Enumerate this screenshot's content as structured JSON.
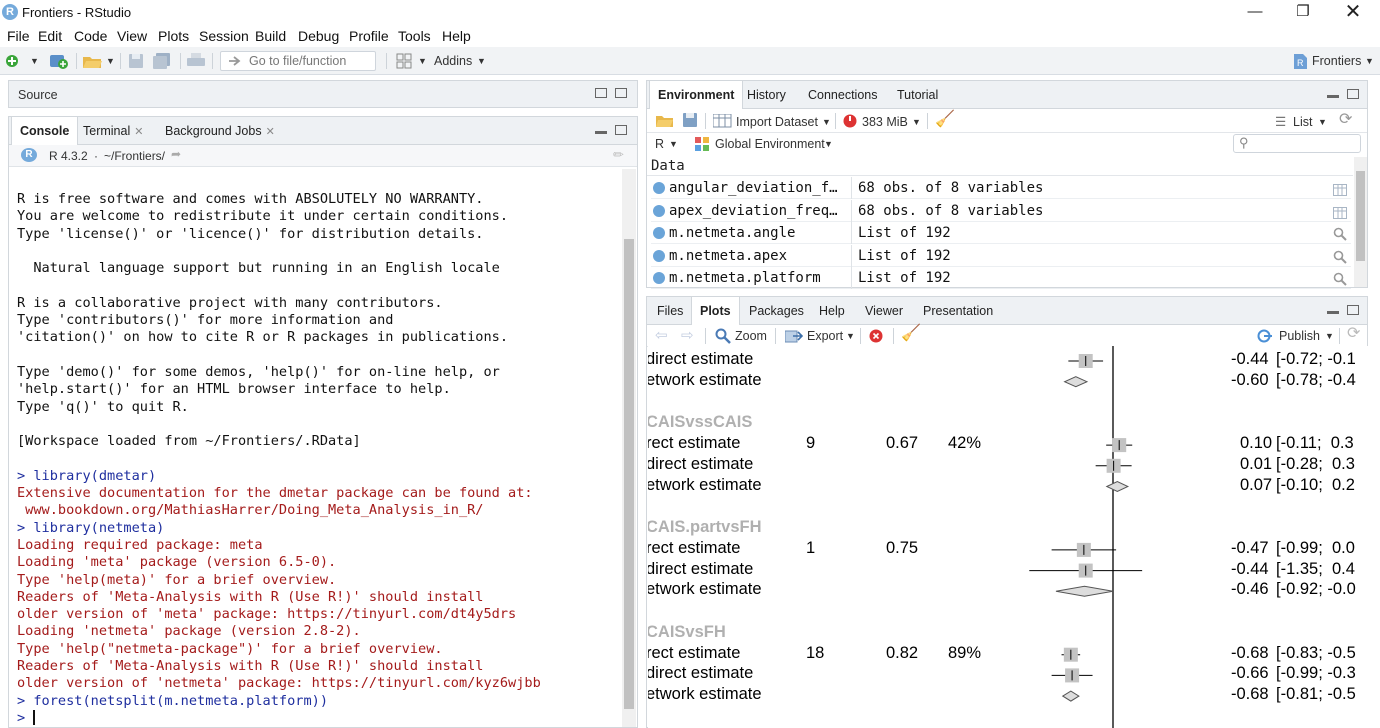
{
  "window": {
    "title": "Frontiers - RStudio",
    "app_icon": "R"
  },
  "menu": [
    "File",
    "Edit",
    "Code",
    "View",
    "Plots",
    "Session",
    "Build",
    "Debug",
    "Profile",
    "Tools",
    "Help"
  ],
  "toolbar": {
    "goto_placeholder": "Go to file/function",
    "addins_label": "Addins",
    "project_label": "Frontiers"
  },
  "source_pane": {
    "title": "Source"
  },
  "console_pane": {
    "tabs": [
      {
        "label": "Console",
        "closable": false
      },
      {
        "label": "Terminal",
        "closable": true
      },
      {
        "label": "Background Jobs",
        "closable": true
      }
    ],
    "r_version": "R 4.3.2",
    "path": "~/Frontiers/",
    "lines": [
      {
        "text": "R is free software and comes with ABSOLUTELY NO WARRANTY.",
        "kind": "black"
      },
      {
        "text": "You are welcome to redistribute it under certain conditions.",
        "kind": "black"
      },
      {
        "text": "Type 'license()' or 'licence()' for distribution details.",
        "kind": "black"
      },
      {
        "text": "",
        "kind": "black"
      },
      {
        "text": "  Natural language support but running in an English locale",
        "kind": "black"
      },
      {
        "text": "",
        "kind": "black"
      },
      {
        "text": "R is a collaborative project with many contributors.",
        "kind": "black"
      },
      {
        "text": "Type 'contributors()' for more information and",
        "kind": "black"
      },
      {
        "text": "'citation()' on how to cite R or R packages in publications.",
        "kind": "black"
      },
      {
        "text": "",
        "kind": "black"
      },
      {
        "text": "Type 'demo()' for some demos, 'help()' for on-line help, or",
        "kind": "black"
      },
      {
        "text": "'help.start()' for an HTML browser interface to help.",
        "kind": "black"
      },
      {
        "text": "Type 'q()' to quit R.",
        "kind": "black"
      },
      {
        "text": "",
        "kind": "black"
      },
      {
        "text": "[Workspace loaded from ~/Frontiers/.RData]",
        "kind": "black"
      },
      {
        "text": "",
        "kind": "black"
      },
      {
        "text": "> library(dmetar)",
        "kind": "blue"
      },
      {
        "text": "Extensive documentation for the dmetar package can be found at:",
        "kind": "red"
      },
      {
        "text": " www.bookdown.org/MathiasHarrer/Doing_Meta_Analysis_in_R/",
        "kind": "red"
      },
      {
        "text": "> library(netmeta)",
        "kind": "blue"
      },
      {
        "text": "Loading required package: meta",
        "kind": "red"
      },
      {
        "text": "Loading 'meta' package (version 6.5-0).",
        "kind": "red"
      },
      {
        "text": "Type 'help(meta)' for a brief overview.",
        "kind": "red"
      },
      {
        "text": "Readers of 'Meta-Analysis with R (Use R!)' should install",
        "kind": "red"
      },
      {
        "text": "older version of 'meta' package: https://tinyurl.com/dt4y5drs",
        "kind": "red"
      },
      {
        "text": "Loading 'netmeta' package (version 2.8-2).",
        "kind": "red"
      },
      {
        "text": "Type 'help(\"netmeta-package\")' for a brief overview.",
        "kind": "red"
      },
      {
        "text": "Readers of 'Meta-Analysis with R (Use R!)' should install",
        "kind": "red"
      },
      {
        "text": "older version of 'netmeta' package: https://tinyurl.com/kyz6wjbb",
        "kind": "red"
      },
      {
        "text": "> forest(netsplit(m.netmeta.platform))",
        "kind": "blue"
      },
      {
        "text": "> ",
        "kind": "blue"
      }
    ]
  },
  "env_pane": {
    "tabs": [
      "Environment",
      "History",
      "Connections",
      "Tutorial"
    ],
    "import_label": "Import Dataset",
    "memory_label": "383 MiB",
    "view_label": "List",
    "lang_label": "R",
    "scope_label": "Global Environment",
    "section_label": "Data",
    "rows": [
      {
        "name": "angular_deviation_f…",
        "value": "68 obs. of 8 variables",
        "action": "table-icon"
      },
      {
        "name": "apex_deviation_freq…",
        "value": "68 obs. of 8 variables",
        "action": "table-icon"
      },
      {
        "name": "m.netmeta.angle",
        "value": "List of  192",
        "action": "magnifier-icon"
      },
      {
        "name": "m.netmeta.apex",
        "value": "List of  192",
        "action": "magnifier-icon"
      },
      {
        "name": "m.netmeta.platform",
        "value": "List of  192",
        "action": "magnifier-icon"
      }
    ]
  },
  "files_pane": {
    "tabs": [
      "Files",
      "Plots",
      "Packages",
      "Help",
      "Viewer",
      "Presentation"
    ],
    "zoom_label": "Zoom",
    "export_label": "Export",
    "publish_label": "Publish"
  },
  "plot": {
    "rows": [
      {
        "kind": "row",
        "label": "direct estimate",
        "n": "",
        "w": "",
        "i2": "",
        "est": "-0.44",
        "ci": "[-0.72; -0.1"
      },
      {
        "kind": "row",
        "label": "etwork estimate",
        "n": "",
        "w": "",
        "i2": "",
        "est": "-0.60",
        "ci": "[-0.78; -0.4"
      },
      {
        "kind": "group",
        "label": "CAISvssCAIS"
      },
      {
        "kind": "row",
        "label": "rect estimate",
        "n": "9",
        "w": "0.67",
        "i2": "42%",
        "est": "0.10",
        "ci": "[-0.11;  0.3"
      },
      {
        "kind": "row",
        "label": "direct estimate",
        "n": "",
        "w": "",
        "i2": "",
        "est": "0.01",
        "ci": "[-0.28;  0.3"
      },
      {
        "kind": "row",
        "label": "etwork estimate",
        "n": "",
        "w": "",
        "i2": "",
        "est": "0.07",
        "ci": "[-0.10;  0.2"
      },
      {
        "kind": "group",
        "label": "CAIS.partvsFH"
      },
      {
        "kind": "row",
        "label": "rect estimate",
        "n": "1",
        "w": "0.75",
        "i2": "",
        "est": "-0.47",
        "ci": "[-0.99;  0.0"
      },
      {
        "kind": "row",
        "label": "direct estimate",
        "n": "",
        "w": "",
        "i2": "",
        "est": "-0.44",
        "ci": "[-1.35;  0.4"
      },
      {
        "kind": "row",
        "label": "etwork estimate",
        "n": "",
        "w": "",
        "i2": "",
        "est": "-0.46",
        "ci": "[-0.92; -0.0"
      },
      {
        "kind": "group",
        "label": "CAISvsFH"
      },
      {
        "kind": "row",
        "label": "rect estimate",
        "n": "18",
        "w": "0.82",
        "i2": "89%",
        "est": "-0.68",
        "ci": "[-0.83; -0.5"
      },
      {
        "kind": "row",
        "label": "direct estimate",
        "n": "",
        "w": "",
        "i2": "",
        "est": "-0.66",
        "ci": "[-0.99; -0.3"
      },
      {
        "kind": "row",
        "label": "etwork estimate",
        "n": "",
        "w": "",
        "i2": "",
        "est": "-0.68",
        "ci": "[-0.81; -0.5"
      }
    ]
  }
}
